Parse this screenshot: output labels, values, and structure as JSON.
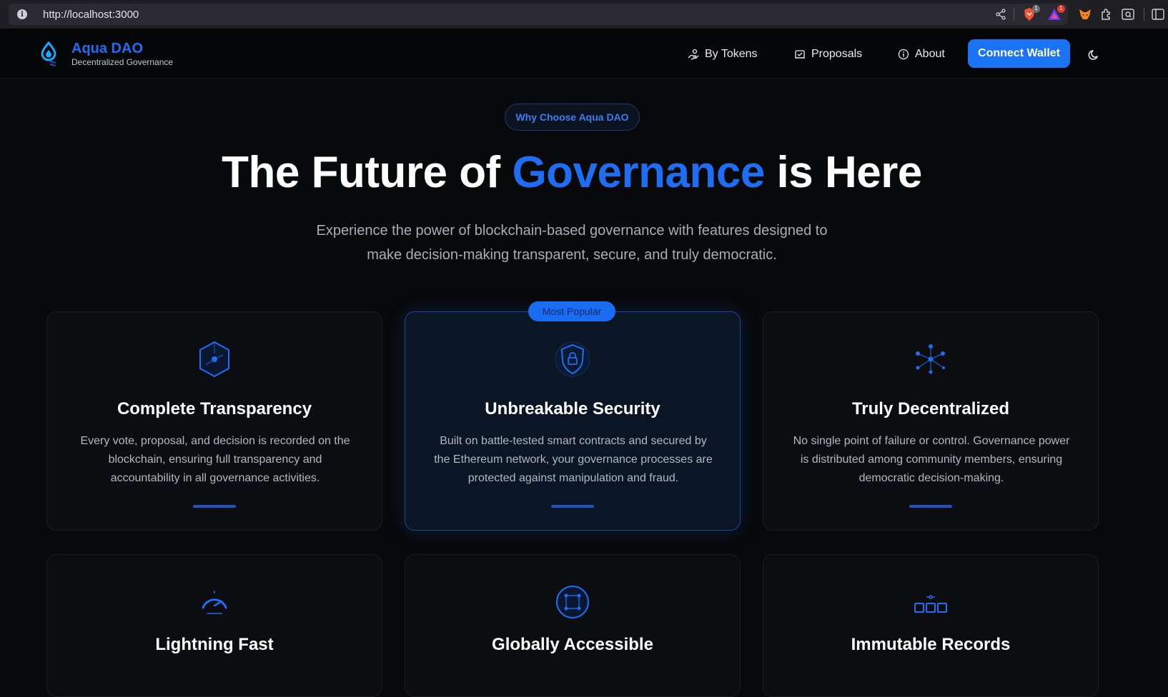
{
  "browser": {
    "url": "http://localhost:3000",
    "brave_badge": "1",
    "rewards_badge": "1"
  },
  "header": {
    "brand_name": "Aqua DAO",
    "brand_tagline": "Decentralized Governance",
    "nav": [
      {
        "label": "By Tokens",
        "icon": "hand-coins-icon"
      },
      {
        "label": "Proposals",
        "icon": "ballot-icon"
      },
      {
        "label": "About",
        "icon": "info-icon"
      }
    ],
    "connect_label": "Connect Wallet",
    "theme_icon": "moon-icon"
  },
  "hero": {
    "pill": "Why Choose Aqua DAO",
    "title_before": "The Future of ",
    "title_accent": "Governance",
    "title_after": " is Here",
    "subtitle_line1": "Experience the power of blockchain-based governance with features designed to",
    "subtitle_line2": "make decision-making transparent, secure, and truly democratic."
  },
  "popular_badge": "Most Popular",
  "features": [
    {
      "title": "Complete Transparency",
      "icon": "hexagon-icon",
      "desc": [
        "Every vote, proposal, and decision is recorded on the",
        "blockchain, ensuring full transparency and",
        "accountability in all governance activities."
      ]
    },
    {
      "title": "Unbreakable Security",
      "icon": "shield-lock-icon",
      "desc": [
        "Built on battle-tested smart contracts and secured by",
        "the Ethereum network, your governance processes are",
        "protected against manipulation and fraud."
      ]
    },
    {
      "title": "Truly Decentralized",
      "icon": "network-icon",
      "desc": [
        "No single point of failure or control. Governance power",
        "is distributed among community members, ensuring",
        "democratic decision-making."
      ]
    },
    {
      "title": "Lightning Fast",
      "icon": "speedometer-icon"
    },
    {
      "title": "Globally Accessible",
      "icon": "globe-icon"
    },
    {
      "title": "Immutable Records",
      "icon": "blocks-icon"
    }
  ],
  "colors": {
    "accent": "#1f6df2",
    "button": "#1a73f5",
    "background": "#08090b"
  }
}
